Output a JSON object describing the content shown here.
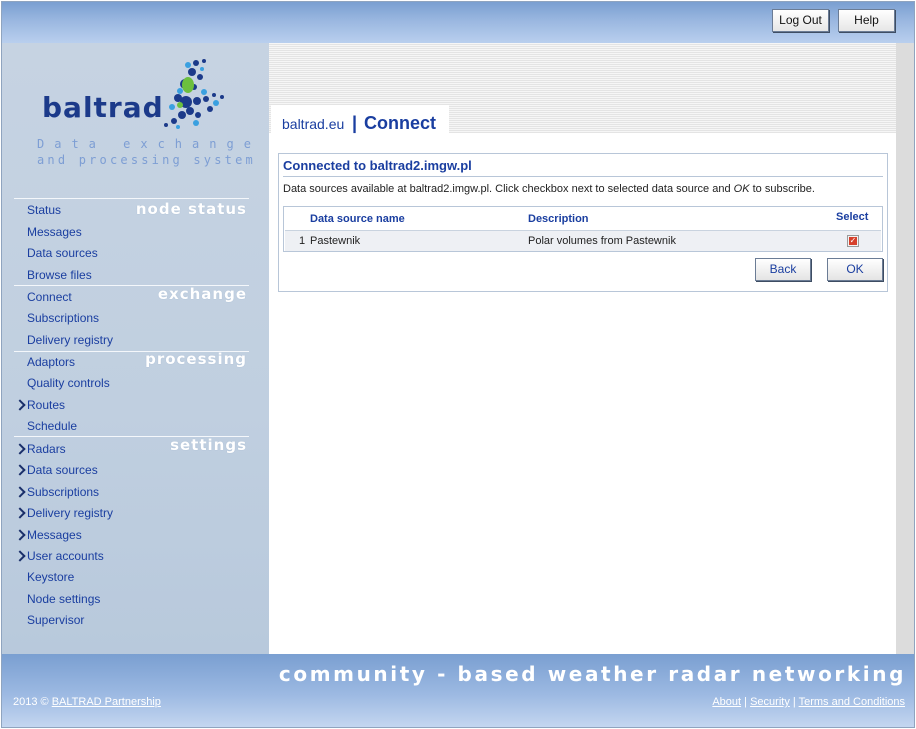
{
  "header": {
    "logout_label": "Log Out",
    "help_label": "Help"
  },
  "logo": {
    "word": "baltrad",
    "tagline_1": "Data exchange",
    "tagline_2": "and processing system"
  },
  "sidebar": {
    "node_status": {
      "title": "node status",
      "items": [
        "Status",
        "Messages",
        "Data sources",
        "Browse files"
      ]
    },
    "exchange": {
      "title": "exchange",
      "items": [
        "Connect",
        "Subscriptions",
        "Delivery registry"
      ]
    },
    "processing": {
      "title": "processing",
      "items": [
        "Adaptors",
        "Quality controls",
        "Routes",
        "Schedule"
      ]
    },
    "settings": {
      "title": "settings",
      "items": [
        "Radars",
        "Data sources",
        "Subscriptions",
        "Delivery registry",
        "Messages",
        "User accounts",
        "Keystore",
        "Node settings",
        "Supervisor"
      ]
    }
  },
  "breadcrumb": {
    "home": "baltrad.eu",
    "separator": "|",
    "page": "Connect"
  },
  "panel": {
    "title": "Connected to baltrad2.imgw.pl",
    "description_pre": "Data sources available at baltrad2.imgw.pl. Click checkbox next to selected data source and ",
    "description_em": "OK",
    "description_post": " to subscribe.",
    "table": {
      "headers": [
        "Data source name",
        "Description",
        "Select"
      ],
      "rows": [
        {
          "index": "1",
          "name": "Pastewnik",
          "description": "Polar volumes from Pastewnik",
          "selected": true
        }
      ]
    },
    "back_label": "Back",
    "ok_label": "OK"
  },
  "footer": {
    "slogan": "community - based weather radar networking",
    "copyright_prefix": "2013 © ",
    "copyright_link": "BALTRAD Partnership",
    "links": [
      "About",
      "Security",
      "Terms and Conditions"
    ],
    "link_sep": "|"
  },
  "colors": {
    "accent": "#1a3ea0",
    "checkbox_checked": "#d6402b",
    "header_blue": "#7a9fd1"
  }
}
